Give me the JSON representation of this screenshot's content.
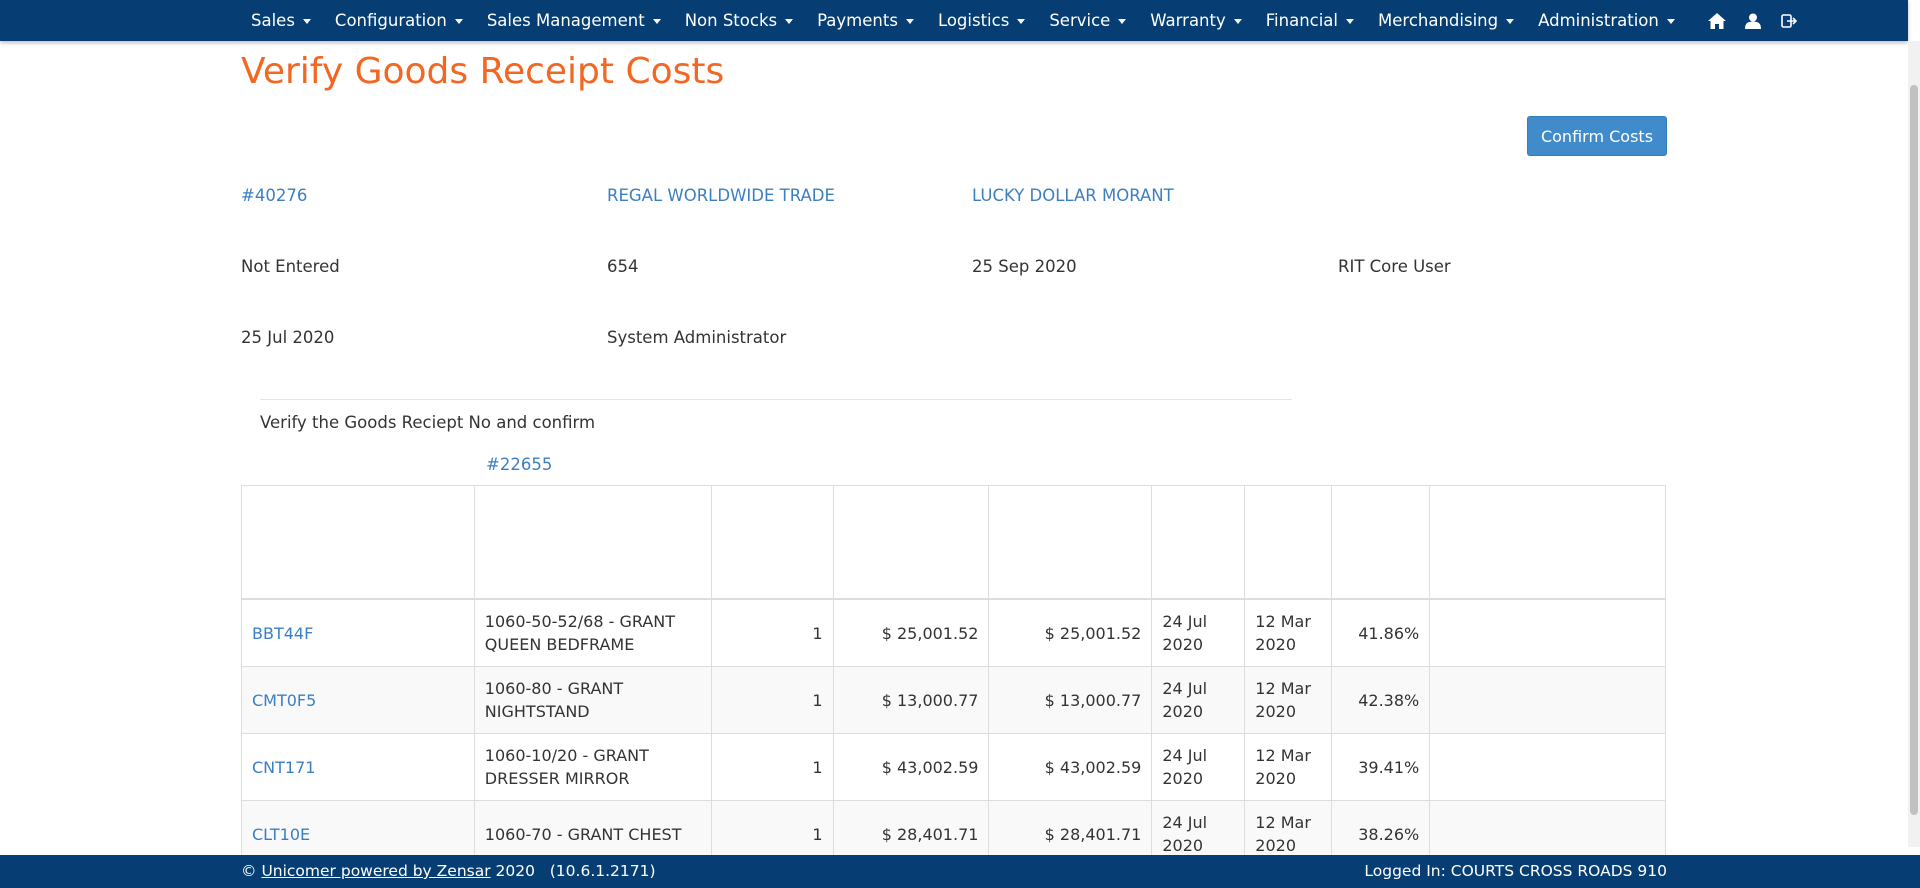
{
  "nav": {
    "items": [
      {
        "label": "Sales"
      },
      {
        "label": "Configuration"
      },
      {
        "label": "Sales Management"
      },
      {
        "label": "Non Stocks"
      },
      {
        "label": "Payments"
      },
      {
        "label": "Logistics"
      },
      {
        "label": "Service"
      },
      {
        "label": "Warranty"
      },
      {
        "label": "Financial"
      },
      {
        "label": "Merchandising"
      },
      {
        "label": "Administration"
      }
    ],
    "icons": [
      "home-icon",
      "user-icon",
      "logout-icon"
    ]
  },
  "page": {
    "title": "Verify Goods Receipt Costs",
    "confirm_label": "Confirm Costs"
  },
  "details": {
    "po_number": "#40276",
    "supplier": "REGAL WORLDWIDE TRADE",
    "location": "LUCKY DOLLAR MORANT",
    "status": "Not Entered",
    "number": "654",
    "date_received": "25 Sep 2020",
    "received_by": "RIT Core User",
    "date_created": "25 Jul 2020",
    "created_by": "System Administrator"
  },
  "verify": {
    "instruction": "Verify the Goods Reciept No and confirm",
    "gr_number": "#22655"
  },
  "table": {
    "rows": [
      {
        "code": "BBT44F",
        "desc_line1": "1060-50-52/68 - GRANT",
        "desc_line2": "QUEEN BEDFRAME",
        "qty": "1",
        "cost": "$ 25,001.52",
        "total": "$ 25,001.52",
        "date1_day": "24 Jul",
        "date1_year": "2020",
        "date2_day": "12 Mar",
        "date2_year": "2020",
        "pct": "41.86%"
      },
      {
        "code": "CMT0F5",
        "desc_line1": "1060-80 - GRANT",
        "desc_line2": "NIGHTSTAND",
        "qty": "1",
        "cost": "$ 13,000.77",
        "total": "$ 13,000.77",
        "date1_day": "24 Jul",
        "date1_year": "2020",
        "date2_day": "12 Mar",
        "date2_year": "2020",
        "pct": "42.38%"
      },
      {
        "code": "CNT171",
        "desc_line1": "1060-10/20 - GRANT",
        "desc_line2": "DRESSER MIRROR",
        "qty": "1",
        "cost": "$ 43,002.59",
        "total": "$ 43,002.59",
        "date1_day": "24 Jul",
        "date1_year": "2020",
        "date2_day": "12 Mar",
        "date2_year": "2020",
        "pct": "39.41%"
      },
      {
        "code": "CLT10E",
        "desc_line1": "1060-70 - GRANT CHEST",
        "desc_line2": "",
        "qty": "1",
        "cost": "$ 28,401.71",
        "total": "$ 28,401.71",
        "date1_day": "24 Jul",
        "date1_year": "2020",
        "date2_day": "12 Mar",
        "date2_year": "2020",
        "pct": "38.26%"
      }
    ]
  },
  "footer": {
    "copyright": "©",
    "company": "Unicomer powered by Zensar",
    "year_version": "2020   (10.6.1.2171)",
    "logged_in": "Logged In: COURTS CROSS ROADS 910"
  }
}
